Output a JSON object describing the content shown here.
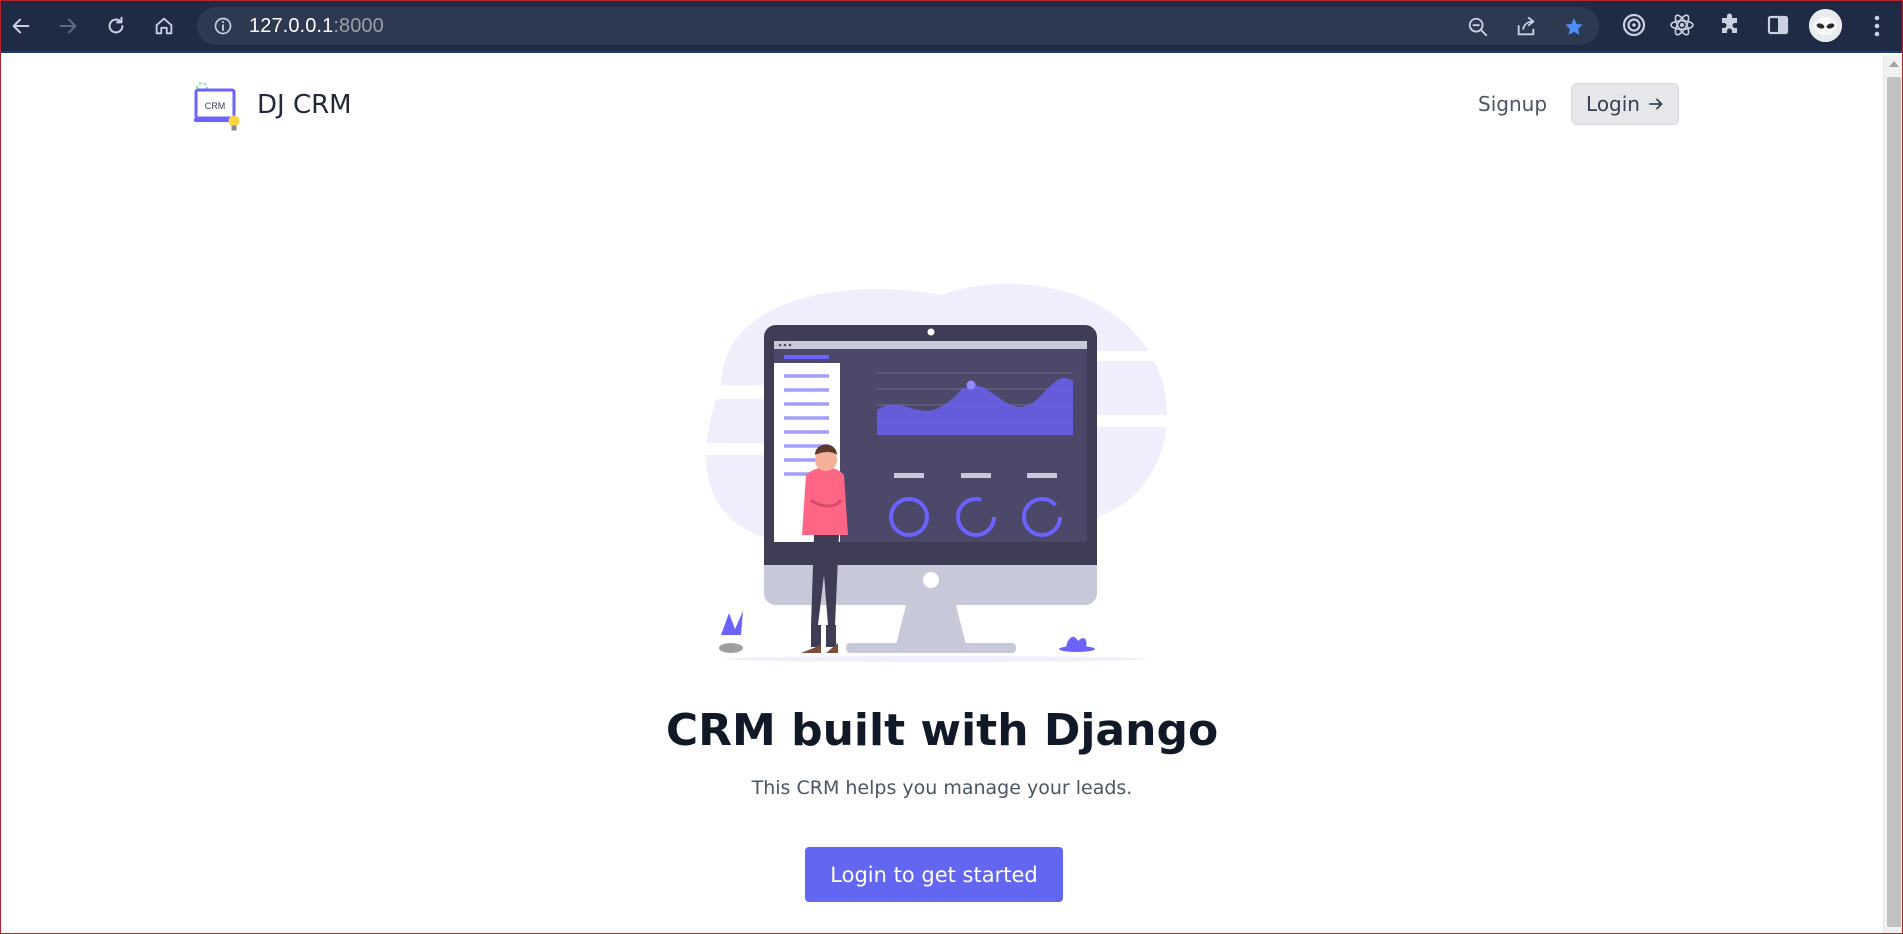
{
  "browser": {
    "url_host": "127.0.0.1",
    "url_port": ":8000",
    "accent": "#1a73e8"
  },
  "navbar": {
    "brand_name": "DJ CRM",
    "logo_text": "CRM",
    "signup_label": "Signup",
    "login_label": "Login"
  },
  "hero": {
    "title": "CRM built with Django",
    "subtitle": "This CRM helps you manage your leads.",
    "cta_label": "Login to get started"
  },
  "colors": {
    "primary": "#6366f1",
    "chrome_bg": "#1f2a44"
  }
}
